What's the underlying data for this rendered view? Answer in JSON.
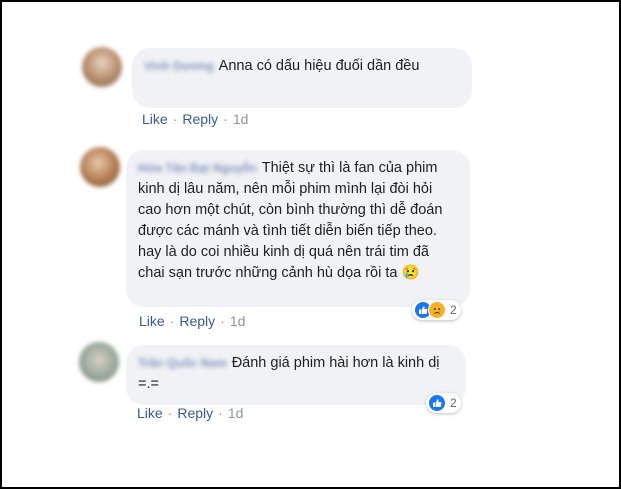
{
  "comments": [
    {
      "author": "Vinh Dương",
      "text": "Anna có dấu hiệu đuối dần đều",
      "like_label": "Like",
      "reply_label": "Reply",
      "time": "1d",
      "avatar_color": "#c9a88d"
    },
    {
      "author": "Hứa Tân Đạt Nguyễn",
      "text": "Thiệt sự thì là fan của phim kinh dị lâu năm, nên mỗi phim mình lại đòi hỏi cao hơn một chút, còn bình thường thì dễ đoán được các mánh và tình tiết diễn biến tiếp theo. hay là do coi nhiều kinh dị quá nên trái tim đã chai sạn trước những cảnh hù dọa rồi ta 😢",
      "like_label": "Like",
      "reply_label": "Reply",
      "time": "1d",
      "reaction_count": "2",
      "reaction_icons": [
        "like-icon",
        "sad-icon"
      ],
      "avatar_color": "#b8865e"
    },
    {
      "author": "Trần Quốc Nam",
      "text": "Đánh giá phim hài hơn là kinh dị =.=",
      "like_label": "Like",
      "reply_label": "Reply",
      "time": "1d",
      "reaction_count": "2",
      "reaction_icons": [
        "like-icon"
      ],
      "avatar_color": "#9aa8a0"
    }
  ],
  "colors": {
    "link": "#385898",
    "bubble": "#f0f2f5",
    "meta": "#90949c",
    "like": "#1877f2",
    "sad": "#f7b125"
  }
}
